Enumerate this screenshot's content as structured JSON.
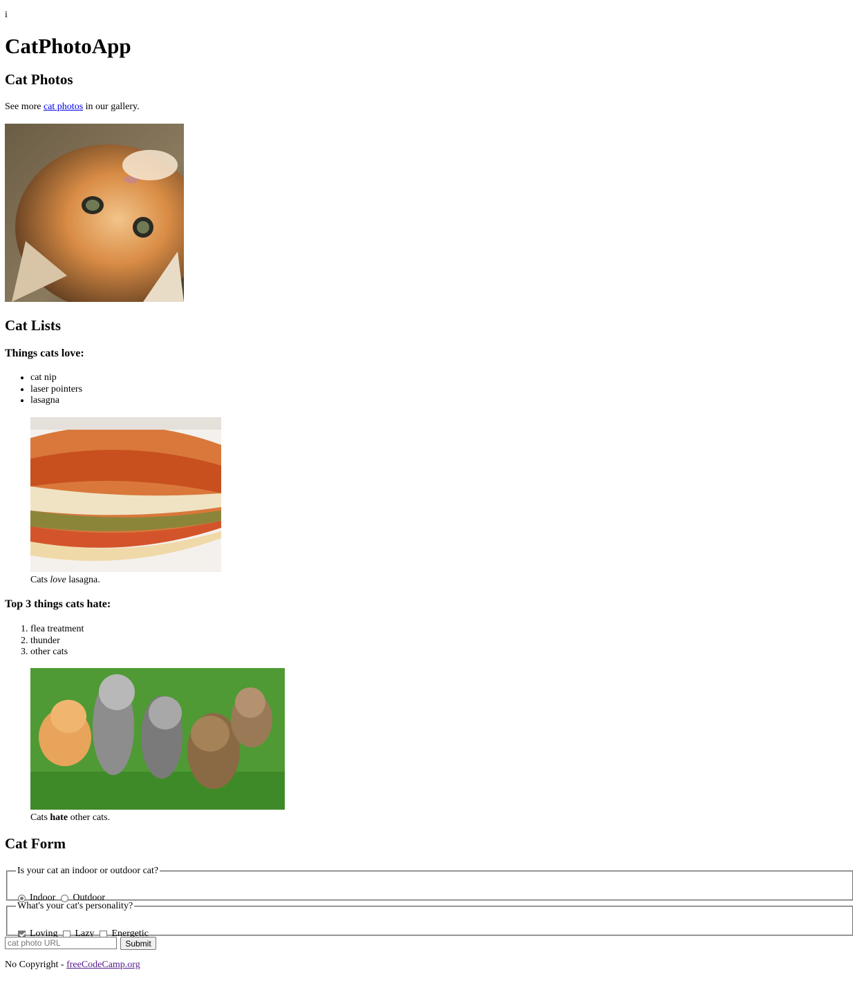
{
  "page": {
    "top_text": "i",
    "title": "CatPhotoApp"
  },
  "photos": {
    "heading": "Cat Photos",
    "intro_before": "See more ",
    "link_text": "cat photos",
    "intro_after": " in our gallery.",
    "image_alt": "A cute orange cat lying on its back."
  },
  "lists": {
    "heading": "Cat Lists",
    "love_heading": "Things cats love:",
    "love_items": [
      "cat nip",
      "laser pointers",
      "lasagna"
    ],
    "lasagna_alt": "A slice of lasagna on a plate.",
    "lasagna_caption_before": "Cats ",
    "lasagna_caption_em": "love",
    "lasagna_caption_after": " lasagna.",
    "hate_heading": "Top 3 things cats hate:",
    "hate_items": [
      "flea treatment",
      "thunder",
      "other cats"
    ],
    "cats_alt": "Five cats looking around a field.",
    "cats_caption_before": "Cats ",
    "cats_caption_strong": "hate",
    "cats_caption_after": " other cats."
  },
  "form": {
    "heading": "Cat Form",
    "location_legend": "Is your cat an indoor or outdoor cat?",
    "location_options": [
      {
        "label": "Indoor",
        "checked": true
      },
      {
        "label": "Outdoor",
        "checked": false
      }
    ],
    "personality_legend": "What's your cat's personality?",
    "personality_options": [
      {
        "label": "Loving",
        "checked": true
      },
      {
        "label": "Lazy",
        "checked": false
      },
      {
        "label": "Energetic",
        "checked": false
      }
    ],
    "url_placeholder": "cat photo URL",
    "url_value": "",
    "submit_label": "Submit"
  },
  "footer": {
    "text_before": "No Copyright - ",
    "link_text": "freeCodeCamp.org"
  },
  "colors": {
    "link": "#0000ee",
    "visited_link": "#551a8b",
    "control_border": "#767676",
    "button_bg": "#efefef"
  }
}
